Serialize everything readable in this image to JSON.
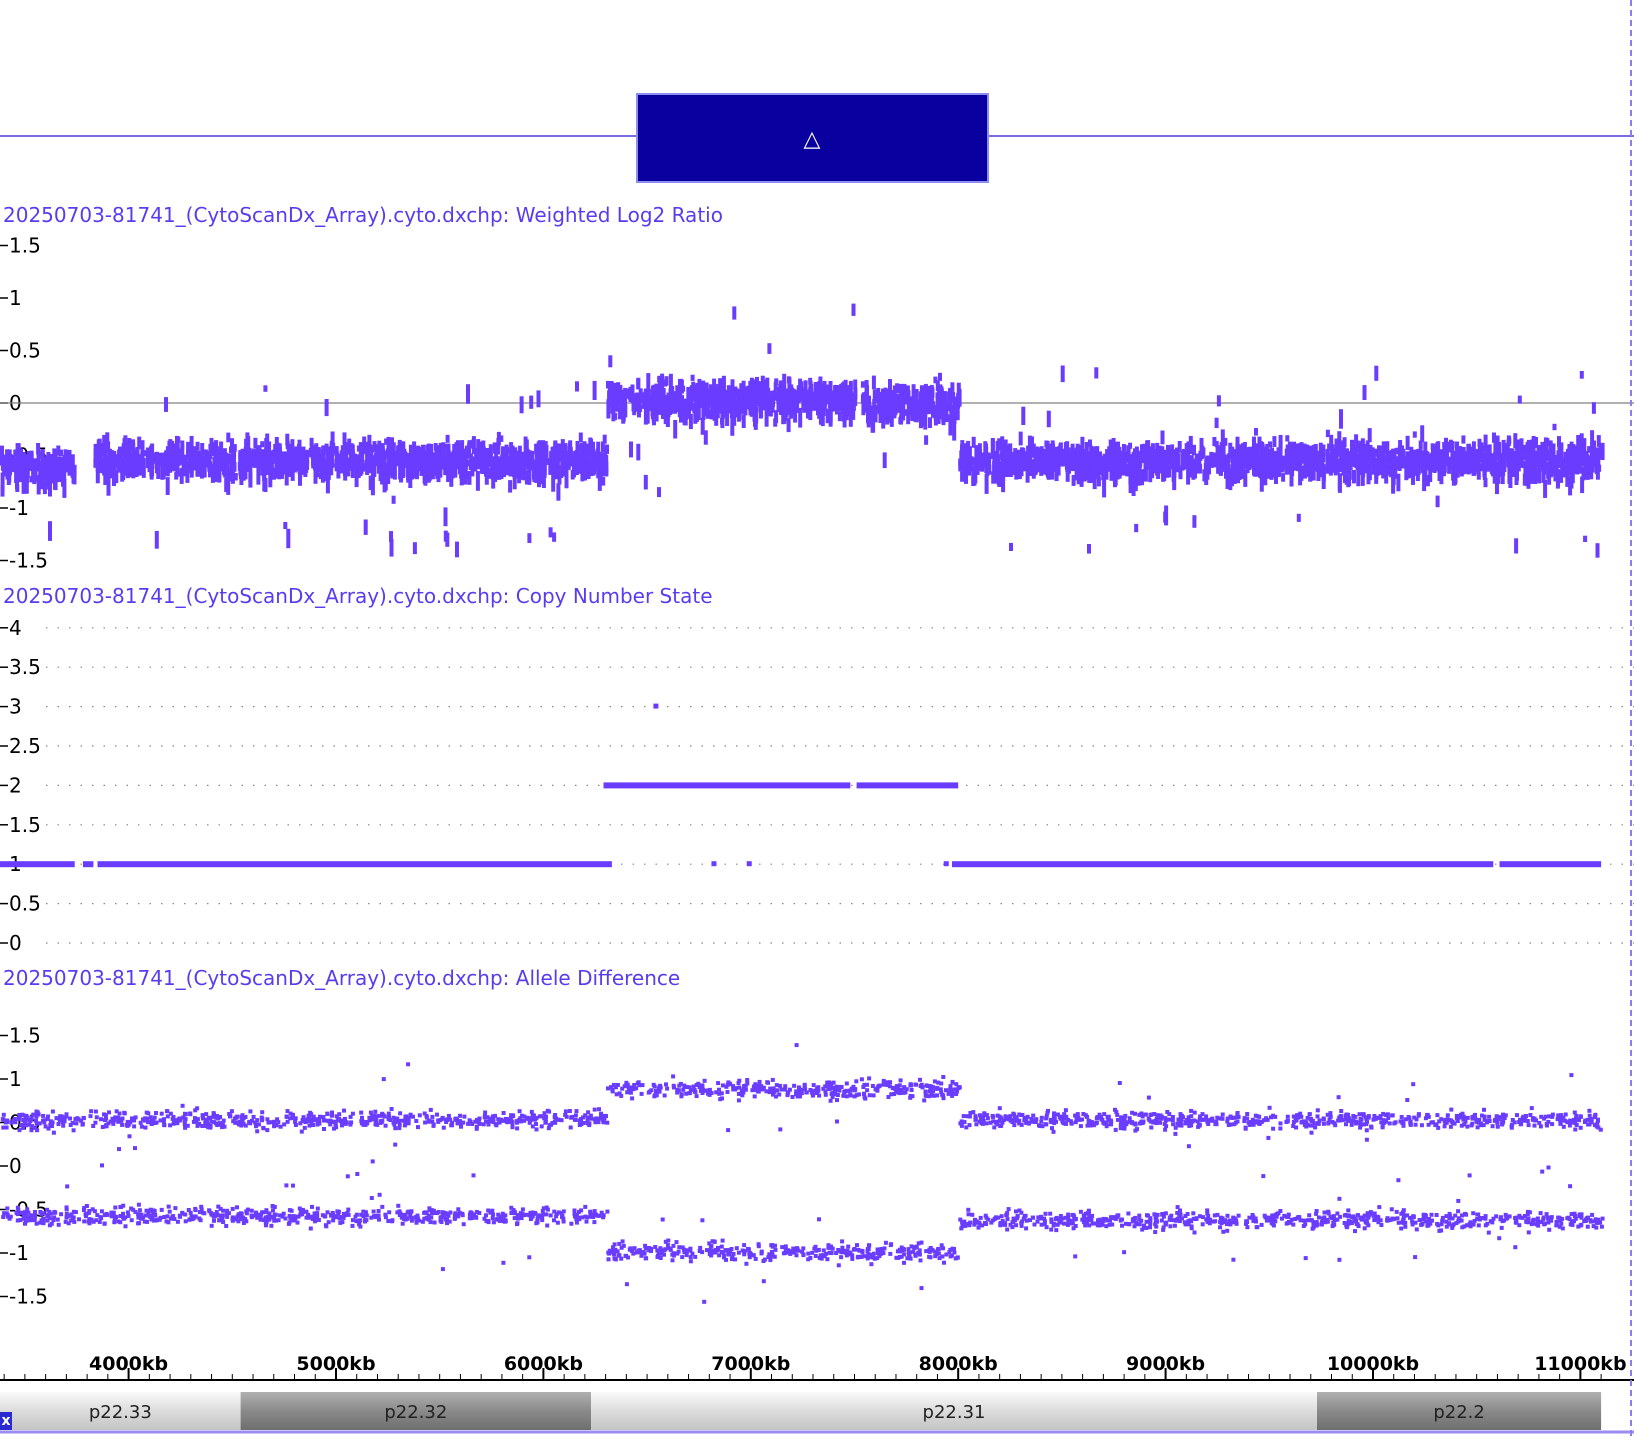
{
  "cnv_marker_symbol": "△",
  "colors": {
    "points": "#6a3cff",
    "cnv_box": "#0a00a0",
    "marker_line": "#4b3cd8",
    "zero_line": "#808080",
    "close_button": "#2a2ad0"
  },
  "close_button_label": "x",
  "chart_data": [
    {
      "type": "scatter",
      "title": "20250703-81741_(CytoScanDx_Array).cyto.dxchp: Weighted Log2 Ratio",
      "yticks": [
        1.5,
        1,
        0.5,
        0,
        -0.5,
        -1,
        -1.5
      ],
      "ytick_labels": [
        "1.5",
        "1",
        "0.5",
        "0",
        "-0.5",
        "-1",
        "-1.5"
      ],
      "ylim": [
        -1.5,
        1.5
      ],
      "baseline": 0,
      "segments": [
        {
          "x_start_kb": 3380,
          "x_end_kb": 3730,
          "mean": -0.6
        },
        {
          "x_start_kb": 3830,
          "x_end_kb": 6300,
          "mean": -0.55
        },
        {
          "x_start_kb": 6300,
          "x_end_kb": 7500,
          "mean": 0.03
        },
        {
          "x_start_kb": 7530,
          "x_end_kb": 8000,
          "mean": 0.0
        },
        {
          "x_start_kb": 8000,
          "x_end_kb": 11100,
          "mean": -0.55
        }
      ]
    },
    {
      "type": "line",
      "title": "20250703-81741_(CytoScanDx_Array).cyto.dxchp: Copy Number State",
      "yticks": [
        4,
        3.5,
        3,
        2.5,
        2,
        1.5,
        1,
        0.5,
        0
      ],
      "ytick_labels": [
        "4",
        "3.5",
        "3",
        "2.5",
        "2",
        "1.5",
        "1",
        "0.5",
        "0"
      ],
      "ylim": [
        0,
        4
      ],
      "grid": true,
      "segments": [
        {
          "x_start_kb": 3380,
          "x_end_kb": 3740,
          "state": 1
        },
        {
          "x_start_kb": 3780,
          "x_end_kb": 3830,
          "state": 1
        },
        {
          "x_start_kb": 3850,
          "x_end_kb": 6330,
          "state": 1
        },
        {
          "x_start_kb": 6290,
          "x_end_kb": 7480,
          "state": 2
        },
        {
          "x_start_kb": 7510,
          "x_end_kb": 8000,
          "state": 2
        },
        {
          "x_start_kb": 7970,
          "x_end_kb": 10580,
          "state": 1
        },
        {
          "x_start_kb": 10610,
          "x_end_kb": 11100,
          "state": 1
        }
      ],
      "isolated_points": [
        {
          "x_kb": 6820,
          "state": 1
        },
        {
          "x_kb": 6990,
          "state": 1
        },
        {
          "x_kb": 7940,
          "state": 1
        },
        {
          "x_kb": 6540,
          "state": 3
        }
      ]
    },
    {
      "type": "scatter",
      "title": "20250703-81741_(CytoScanDx_Array).cyto.dxchp: Allele Difference",
      "yticks": [
        1.5,
        1,
        0.5,
        0,
        -0.5,
        -1,
        -1.5
      ],
      "ytick_labels": [
        "1.5",
        "1",
        "0.5",
        "0",
        "-0.5",
        "-1",
        "-1.5"
      ],
      "ylim": [
        -1.5,
        1.5
      ],
      "bands": [
        {
          "x_start_kb": 3380,
          "x_end_kb": 6300,
          "upper": 0.55,
          "lower": -0.55
        },
        {
          "x_start_kb": 6300,
          "x_end_kb": 8000,
          "upper": 0.9,
          "lower": -0.97
        },
        {
          "x_start_kb": 8000,
          "x_end_kb": 11100,
          "upper": 0.55,
          "lower": -0.6
        }
      ]
    }
  ],
  "x_axis": {
    "unit": "kb",
    "range_kb": [
      3380,
      11100
    ],
    "ticks": [
      {
        "kb": 4000,
        "label": "4000kb"
      },
      {
        "kb": 5000,
        "label": "5000kb"
      },
      {
        "kb": 6000,
        "label": "6000kb"
      },
      {
        "kb": 7000,
        "label": "7000kb"
      },
      {
        "kb": 8000,
        "label": "8000kb"
      },
      {
        "kb": 9000,
        "label": "9000kb"
      },
      {
        "kb": 10000,
        "label": "10000kb"
      },
      {
        "kb": 11000,
        "label": "11000kb"
      }
    ]
  },
  "cnv_region_kb": [
    6290,
    7990
  ],
  "ideogram": [
    {
      "label": "p22.33",
      "start_kb": 3380,
      "end_kb": 4540,
      "shade": "light"
    },
    {
      "label": "p22.32",
      "start_kb": 4540,
      "end_kb": 6230,
      "shade": "dark"
    },
    {
      "label": "p22.31",
      "start_kb": 6230,
      "end_kb": 9730,
      "shade": "light"
    },
    {
      "label": "p22.2",
      "start_kb": 9730,
      "end_kb": 11100,
      "shade": "dark"
    }
  ]
}
